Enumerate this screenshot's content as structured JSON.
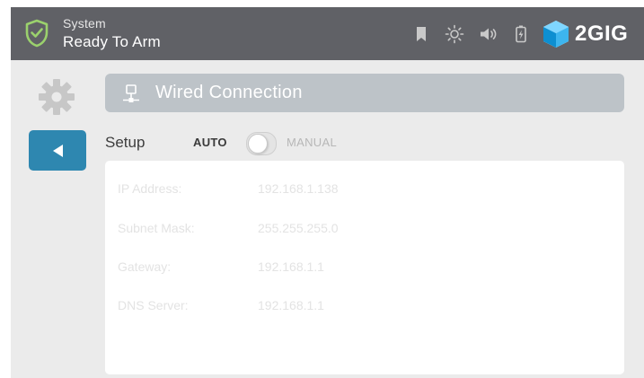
{
  "status_bar": {
    "title": "System",
    "status": "Ready To Arm",
    "brand": "2GIG",
    "icons": [
      "shield-check-icon",
      "bookmark-icon",
      "brightness-icon",
      "volume-icon",
      "battery-charging-icon",
      "2gig-logo-cube-icon"
    ],
    "colors": {
      "bar": "#606166",
      "shield": "#9bd16d"
    }
  },
  "panel": {
    "title": "Wired Connection",
    "setup_label": "Setup",
    "mode_auto": "AUTO",
    "mode_manual": "MANUAL",
    "mode_selected": "AUTO",
    "back_color": "#2e87b0"
  },
  "network": {
    "rows": [
      {
        "label": "IP Address:",
        "value": "192.168.1.138"
      },
      {
        "label": "Subnet Mask:",
        "value": "255.255.255.0"
      },
      {
        "label": "Gateway:",
        "value": "192.168.1.1"
      },
      {
        "label": "DNS Server:",
        "value": "192.168.1.1"
      }
    ]
  }
}
